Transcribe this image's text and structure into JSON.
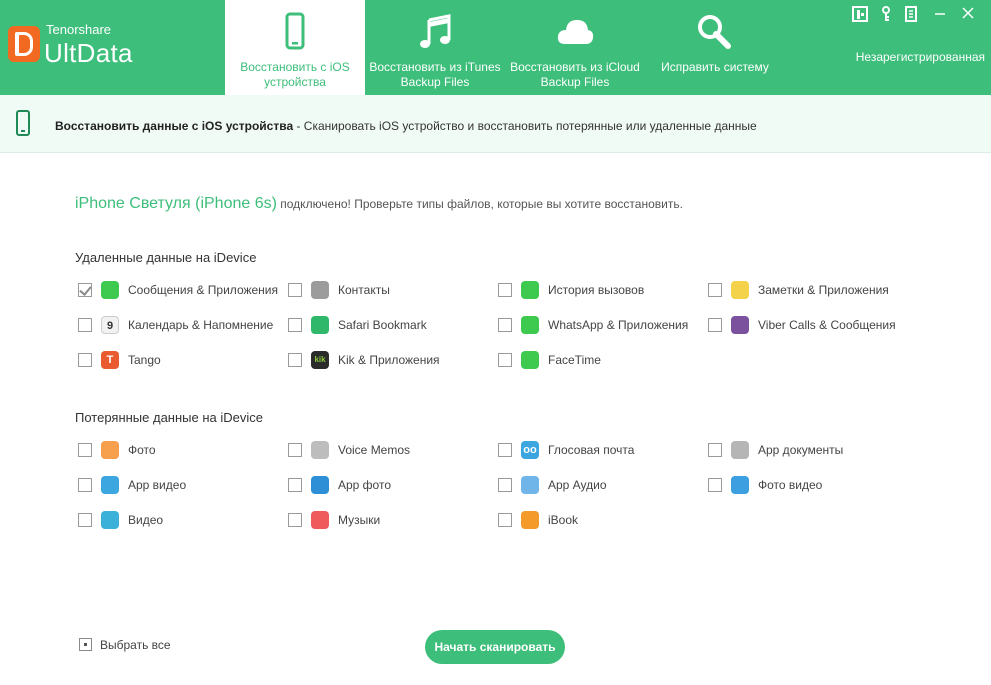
{
  "brand": {
    "small": "Tenorshare",
    "big": "UltData"
  },
  "tabs": [
    {
      "label": "Восстановить с iOS устройства",
      "icon": "phone-icon"
    },
    {
      "label": "Восстановить из iTunes Backup Files",
      "icon": "music-note-icon"
    },
    {
      "label": "Восстановить из iCloud Backup Files",
      "icon": "cloud-icon"
    },
    {
      "label": "Исправить систему",
      "icon": "wrench-icon"
    }
  ],
  "window_controls": {
    "unregistered": "Незарегистрированная"
  },
  "subheader": {
    "title": "Восстановить данные с iOS устройства",
    "description": " - Сканировать iOS устройство и восстановить потерянные или удаленные данные"
  },
  "device": {
    "name": "iPhone Светуля (iPhone 6s)",
    "message": " подключено! Проверьте типы файлов, которые вы хотите восстановить."
  },
  "deleted": {
    "title": "Удаленные данные на iDevice",
    "items": [
      {
        "label": "Сообщения & Приложения",
        "checked": true,
        "icon": "messages-icon",
        "color": "#3ec94f"
      },
      {
        "label": "Контакты",
        "checked": false,
        "icon": "contacts-icon",
        "color": "#9c9c9c"
      },
      {
        "label": "История вызовов",
        "checked": false,
        "icon": "phone-call-icon",
        "color": "#3ec94f"
      },
      {
        "label": "Заметки & Приложения",
        "checked": false,
        "icon": "notes-icon",
        "color": "#f4d34a"
      },
      {
        "label": "Календарь & Напомнение",
        "checked": false,
        "icon": "calendar-icon",
        "color": "#f2f2f2",
        "glyph": "9"
      },
      {
        "label": "Safari Bookmark",
        "checked": false,
        "icon": "safari-icon",
        "color": "#2fb86a"
      },
      {
        "label": "WhatsApp & Приложения",
        "checked": false,
        "icon": "whatsapp-icon",
        "color": "#3ec94f"
      },
      {
        "label": "Viber Calls & Сообщения",
        "checked": false,
        "icon": "viber-icon",
        "color": "#7b519d"
      },
      {
        "label": "Tango",
        "checked": false,
        "icon": "tango-icon",
        "color": "#ea5a2f",
        "glyph": "T"
      },
      {
        "label": "Kik & Приложения",
        "checked": false,
        "icon": "kik-icon",
        "color": "#2b2b2b",
        "glyph": "kik"
      },
      {
        "label": "FaceTime",
        "checked": false,
        "icon": "facetime-icon",
        "color": "#3ec94f"
      }
    ]
  },
  "lost": {
    "title": "Потерянные данные на iDevice",
    "items": [
      {
        "label": "Фото",
        "checked": false,
        "icon": "photos-icon",
        "color": "#f6a04d"
      },
      {
        "label": "Voice Memos",
        "checked": false,
        "icon": "voice-memos-icon",
        "color": "#bdbdbd"
      },
      {
        "label": "Глосовая почта",
        "checked": false,
        "icon": "voicemail-icon",
        "color": "#3ba6e0",
        "glyph": "oo"
      },
      {
        "label": "App документы",
        "checked": false,
        "icon": "document-icon",
        "color": "#b5b5b5"
      },
      {
        "label": "App видео",
        "checked": false,
        "icon": "app-video-icon",
        "color": "#3ba6e0"
      },
      {
        "label": "App фото",
        "checked": false,
        "icon": "app-photo-icon",
        "color": "#2d8fd6"
      },
      {
        "label": "App Аудио",
        "checked": false,
        "icon": "microphone-icon",
        "color": "#6fb5ea"
      },
      {
        "label": "Фото видео",
        "checked": false,
        "icon": "photo-video-icon",
        "color": "#3b9fe0"
      },
      {
        "label": "Видео",
        "checked": false,
        "icon": "video-clapper-icon",
        "color": "#3bb0d8"
      },
      {
        "label": "Музыки",
        "checked": false,
        "icon": "music-icon",
        "color": "#ef5a5a"
      },
      {
        "label": "iBook",
        "checked": false,
        "icon": "ibook-icon",
        "color": "#f39a2b"
      }
    ]
  },
  "footer": {
    "select_all": "Выбрать все",
    "scan_button": "Начать сканировать"
  },
  "colors": {
    "accent": "#3dbe7a",
    "header": "#3dbe7a"
  }
}
